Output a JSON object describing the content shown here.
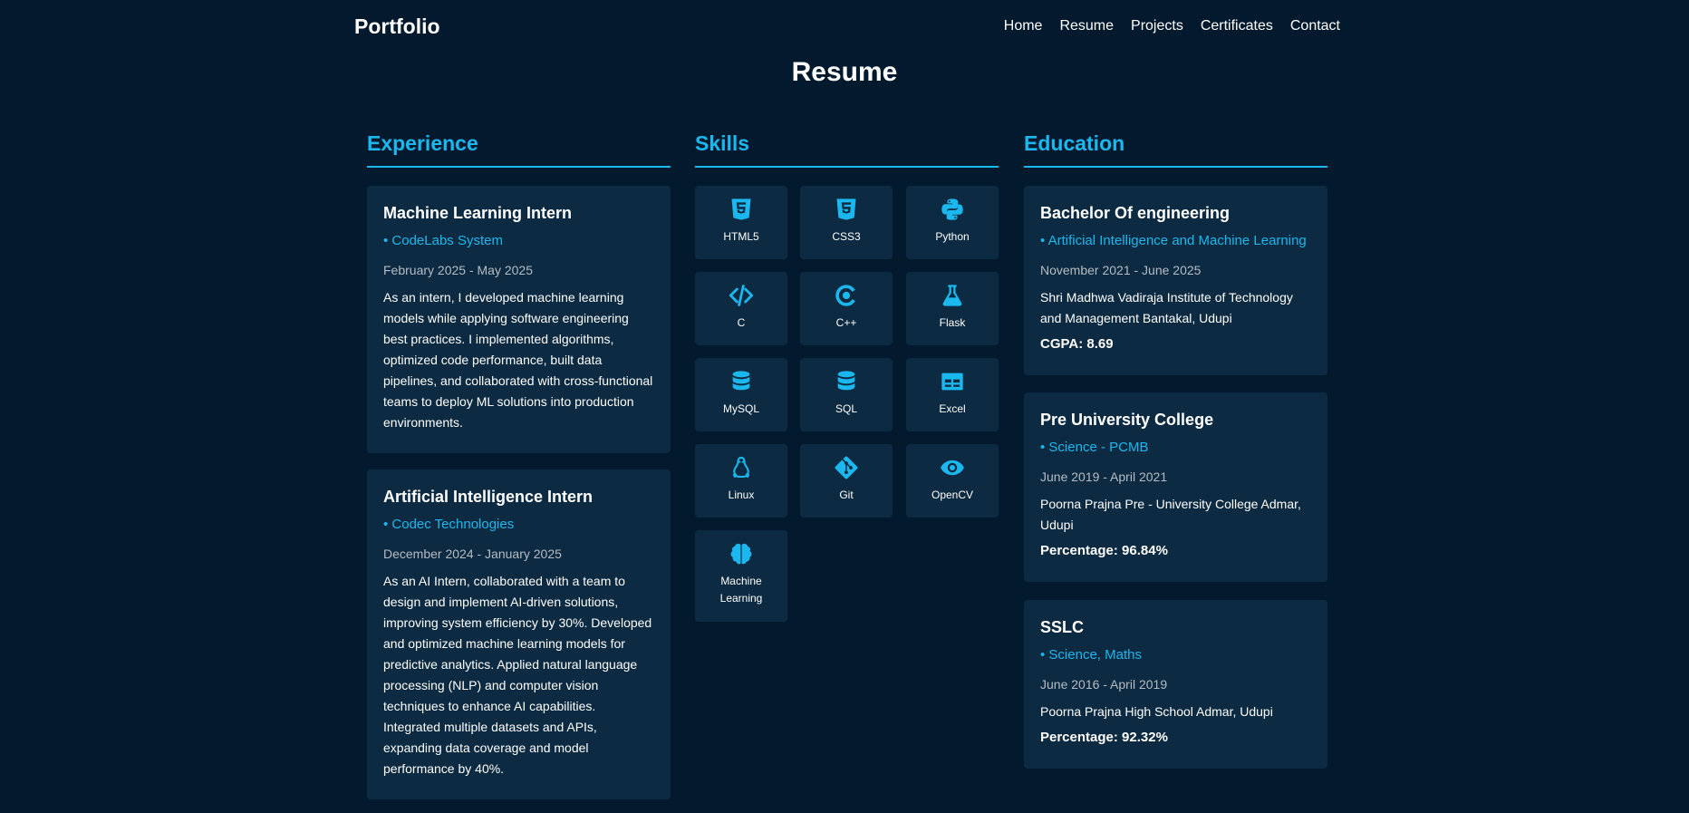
{
  "nav": {
    "brand": "Portfolio",
    "links": [
      "Home",
      "Resume",
      "Projects",
      "Certificates",
      "Contact"
    ]
  },
  "page": {
    "title": "Resume"
  },
  "experience": {
    "heading": "Experience",
    "items": [
      {
        "title": "Machine Learning Intern",
        "company": "• CodeLabs System",
        "dates": "February 2025 - May 2025",
        "description": "As an intern, I developed machine learning models while applying software engineering best practices. I implemented algorithms, optimized code performance, built data pipelines, and collaborated with cross-functional teams to deploy ML solutions into production environments."
      },
      {
        "title": "Artificial Intelligence Intern",
        "company": "• Codec Technologies",
        "dates": "December 2024 - January 2025",
        "description": "As an AI Intern, collaborated with a team to design and implement AI-driven solutions, improving system efficiency by 30%. Developed and optimized machine learning models for predictive analytics. Applied natural language processing (NLP) and computer vision techniques to enhance AI capabilities. Integrated multiple datasets and APIs, expanding data coverage and model performance by 40%."
      }
    ]
  },
  "skills": {
    "heading": "Skills",
    "items": [
      {
        "label": "HTML5",
        "icon": "html5-icon"
      },
      {
        "label": "CSS3",
        "icon": "css3-icon"
      },
      {
        "label": "Python",
        "icon": "python-icon"
      },
      {
        "label": "C",
        "icon": "code-icon"
      },
      {
        "label": "C++",
        "icon": "cplusplus-icon"
      },
      {
        "label": "Flask",
        "icon": "flask-icon"
      },
      {
        "label": "MySQL",
        "icon": "database-icon"
      },
      {
        "label": "SQL",
        "icon": "database-icon"
      },
      {
        "label": "Excel",
        "icon": "table-icon"
      },
      {
        "label": "Linux",
        "icon": "linux-icon"
      },
      {
        "label": "Git",
        "icon": "git-icon"
      },
      {
        "label": "OpenCV",
        "icon": "eye-icon"
      },
      {
        "label": "Machine Learning",
        "icon": "brain-icon"
      }
    ]
  },
  "education": {
    "heading": "Education",
    "items": [
      {
        "title": "Bachelor Of engineering",
        "field": "• Artificial Intelligence and Machine Learning",
        "dates": "November 2021 - June 2025",
        "institution": "Shri Madhwa Vadiraja Institute of Technology and Management Bantakal, Udupi",
        "score": "CGPA: 8.69"
      },
      {
        "title": "Pre University College",
        "field": "• Science - PCMB",
        "dates": "June 2019 - April 2021",
        "institution": "Poorna Prajna Pre - University College Admar, Udupi",
        "score": "Percentage: 96.84%"
      },
      {
        "title": "SSLC",
        "field": "• Science, Maths",
        "dates": "June 2016 - April 2019",
        "institution": "Poorna Prajna High School Admar, Udupi",
        "score": "Percentage: 92.32%"
      }
    ]
  },
  "colors": {
    "background": "#031a2e",
    "card": "#0c2a41",
    "accent": "#1ab8ee"
  }
}
